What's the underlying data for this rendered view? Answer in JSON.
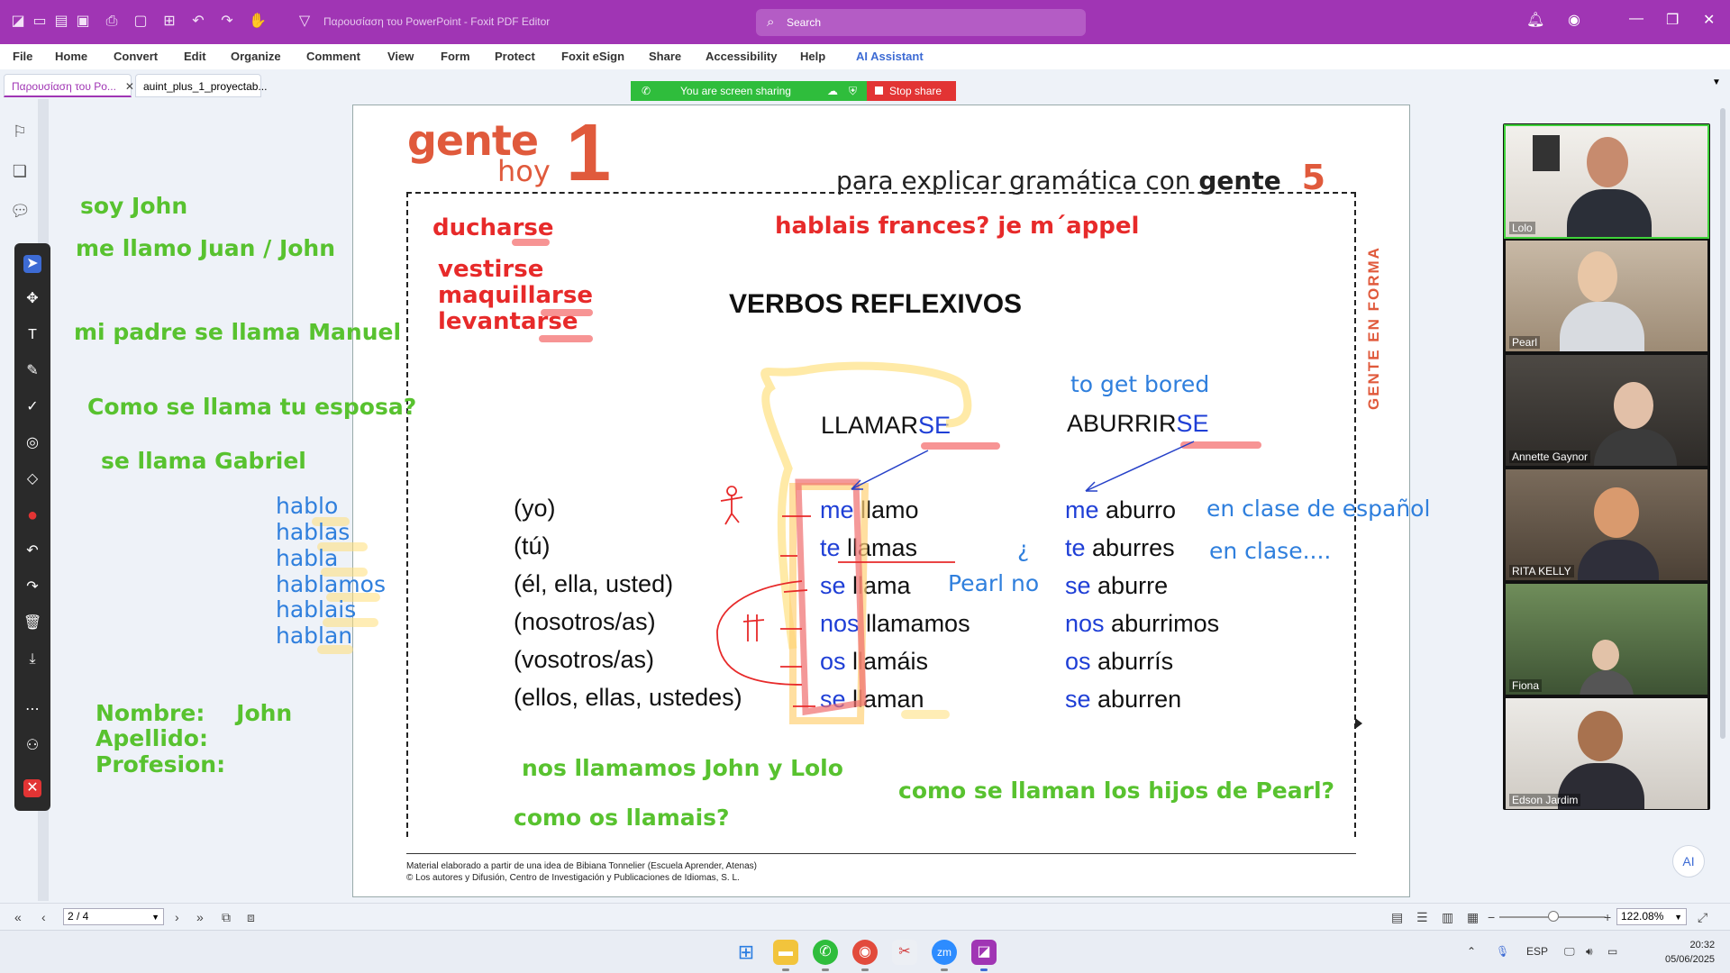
{
  "titlebar": {
    "doc_title": "Παρουσίαση του PowerPoint - Foxit PDF Editor",
    "search_placeholder": "Search"
  },
  "menu": [
    "File",
    "Home",
    "Convert",
    "Edit",
    "Organize",
    "Comment",
    "View",
    "Form",
    "Protect",
    "Foxit eSign",
    "Share",
    "Accessibility",
    "Help",
    "AI Assistant"
  ],
  "tabs": [
    {
      "label": "Παρουσίαση του Po...",
      "active": true
    },
    {
      "label": "auint_plus_1_proyectab...",
      "active": false
    }
  ],
  "screen_share": {
    "status": "You are screen sharing",
    "stop_label": "Stop share"
  },
  "document": {
    "logo_word": "gente",
    "logo_hoy": "hoy",
    "logo_number": "1",
    "header_text": "para explicar gramática con",
    "header_bold": "gente",
    "header_number": "5",
    "side_label": "GENTE EN FORMA",
    "title": "VERBOS REFLEXIVOS",
    "verb1_root": "LLAMAR",
    "verb1_suffix": "SE",
    "verb2_root": "ABURRIR",
    "verb2_suffix": "SE",
    "verb2_translation": "to get bored",
    "pronouns": [
      "(yo)",
      "(tú)",
      "(él, ella, usted)",
      "(nosotros/as)",
      "(vosotros/as)",
      "(ellos, ellas, ustedes)"
    ],
    "llamarse_conj": [
      {
        "p": "me",
        "v": " llamo"
      },
      {
        "p": "te",
        "v": " llamas"
      },
      {
        "p": "se",
        "v": " llama"
      },
      {
        "p": "nos",
        "v": " llamamos"
      },
      {
        "p": "os",
        "v": " llamáis"
      },
      {
        "p": "se",
        "v": " llaman"
      }
    ],
    "aburrirse_conj": [
      {
        "p": "me",
        "v": " aburro"
      },
      {
        "p": "te",
        "v": " aburres"
      },
      {
        "p": "se",
        "v": " aburre"
      },
      {
        "p": "nos",
        "v": " aburrimos"
      },
      {
        "p": "os",
        "v": " aburrís"
      },
      {
        "p": "se",
        "v": " aburren"
      }
    ],
    "footer_line1": "Material elaborado a partir de una idea de Bibiana Tonnelier (Escuela Aprender, Atenas)",
    "footer_line2": "© Los autores y Difusión, Centro de Investigación y Publicaciones de Idiomas, S. L."
  },
  "annotations": {
    "red": [
      "ducharse",
      "vestirse",
      "maquillarse",
      "levantarse",
      "hablais frances? je m´appel"
    ],
    "green": [
      "soy John",
      "me llamo Juan / John",
      "mi padre se llama Manuel",
      "Como se llama tu esposa?",
      "se llama Gabriel",
      "Nombre:    John",
      "Apellido:",
      "Profesion:",
      "nos llamamos John y Lolo",
      "como se llaman los hijos de Pearl?",
      "como os llamais?"
    ],
    "blue_hablar": [
      "hablo",
      "hablas",
      "habla",
      "hablamos",
      "hablais",
      "hablan"
    ],
    "blue_notes": [
      "en clase de español",
      "en clase....",
      "¿",
      "Pearl no"
    ]
  },
  "participants": [
    {
      "name": "Lolo",
      "speaking": true
    },
    {
      "name": "Pearl",
      "speaking": false
    },
    {
      "name": "Annette Gaynor",
      "speaking": false
    },
    {
      "name": "RITA KELLY",
      "speaking": false
    },
    {
      "name": "Fiona",
      "speaking": false
    },
    {
      "name": "Edson Jardim",
      "speaking": false
    }
  ],
  "statusbar": {
    "page": "2 / 4",
    "zoom": "122.08%"
  },
  "taskbar": {
    "lang": "ESP",
    "time": "20:32",
    "date": "05/06/2025"
  },
  "colors": {
    "accent": "#a035b4",
    "ink_red": "#e72a2a",
    "ink_green": "#58c22f",
    "ink_blue": "#2f7fdd",
    "brand_orange": "#e05a3c"
  }
}
